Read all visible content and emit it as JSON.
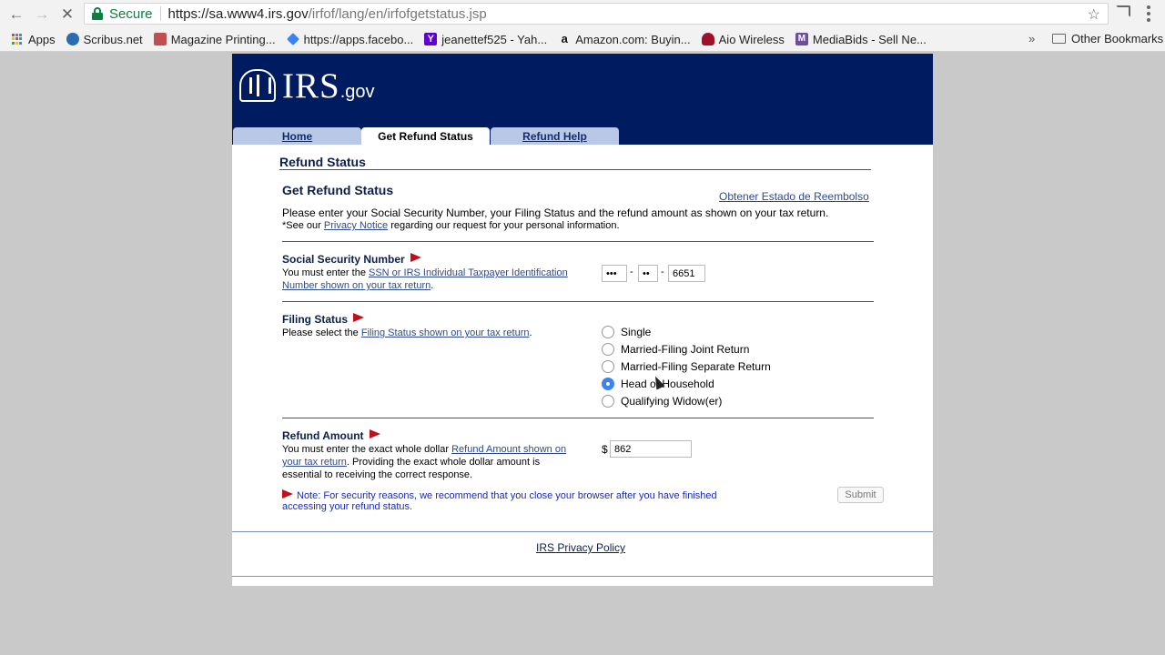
{
  "browser": {
    "secure_label": "Secure",
    "url_host": "https://sa.www4.irs.gov",
    "url_path": "/irfof/lang/en/irfofgetstatus.jsp",
    "bookmarks": [
      {
        "label": "Apps",
        "icon": "apps-grid-icon",
        "color": "#4285f4"
      },
      {
        "label": "Scribus.net",
        "icon": "scribus-icon",
        "color": "#2b6cb0"
      },
      {
        "label": "Magazine Printing...",
        "icon": "magazine-icon",
        "color": "#c05050"
      },
      {
        "label": "https://apps.facebo...",
        "icon": "diamond-icon",
        "color": "#3b82f6"
      },
      {
        "label": "jeanettef525 - Yah...",
        "icon": "yahoo-icon",
        "color": "#5f01d1"
      },
      {
        "label": "Amazon.com: Buyin...",
        "icon": "amazon-icon",
        "color": "#111111"
      },
      {
        "label": "Aio Wireless",
        "icon": "aio-icon",
        "color": "#a0102a"
      },
      {
        "label": "MediaBids - Sell Ne...",
        "icon": "mediabids-icon",
        "color": "#6b4f9e"
      }
    ],
    "overflow_label": "»",
    "other_bookmarks": "Other Bookmarks"
  },
  "header": {
    "logo_text": "IRS",
    "logo_suffix": ".gov",
    "tabs": [
      {
        "label": "Home",
        "active": false
      },
      {
        "label": "Get Refund Status",
        "active": true
      },
      {
        "label": "Refund Help",
        "active": false
      }
    ]
  },
  "main": {
    "page_title": "Refund Status",
    "form_title": "Get Refund Status",
    "spanish_link": "Obtener Estado de Reembolso",
    "intro": "Please enter your Social Security Number, your Filing Status and the refund amount as shown on your tax return.",
    "privacy_prefix": "*See our ",
    "privacy_link": "Privacy Notice",
    "privacy_suffix": " regarding our request for your personal information.",
    "ssn": {
      "title": "Social Security Number",
      "help_prefix": "You must enter the ",
      "help_link": "SSN or IRS Individual Taxpayer Identification Number shown on your tax return",
      "help_suffix": ".",
      "part1": "•••",
      "part2": "••",
      "part3": "6651",
      "sep": "-"
    },
    "filing": {
      "title": "Filing Status",
      "help_prefix": "Please select the ",
      "help_link": "Filing Status shown on your tax return",
      "help_suffix": ".",
      "options": [
        {
          "label": "Single",
          "checked": false
        },
        {
          "label": "Married-Filing Joint Return",
          "checked": false
        },
        {
          "label": "Married-Filing Separate Return",
          "checked": false
        },
        {
          "label": "Head of Household",
          "checked": true
        },
        {
          "label": "Qualifying Widow(er)",
          "checked": false
        }
      ]
    },
    "refund": {
      "title": "Refund Amount",
      "help_prefix": "You must enter the exact whole dollar ",
      "help_link": "Refund Amount shown on your tax return",
      "help_suffix": ". Providing the exact whole dollar amount is essential to receiving the correct response.",
      "currency": "$",
      "value": "862"
    },
    "note": "Note: For security reasons, we recommend that you close your browser after you have finished accessing your refund status.",
    "submit_label": "Submit"
  },
  "footer": {
    "privacy_policy": "IRS Privacy Policy"
  }
}
